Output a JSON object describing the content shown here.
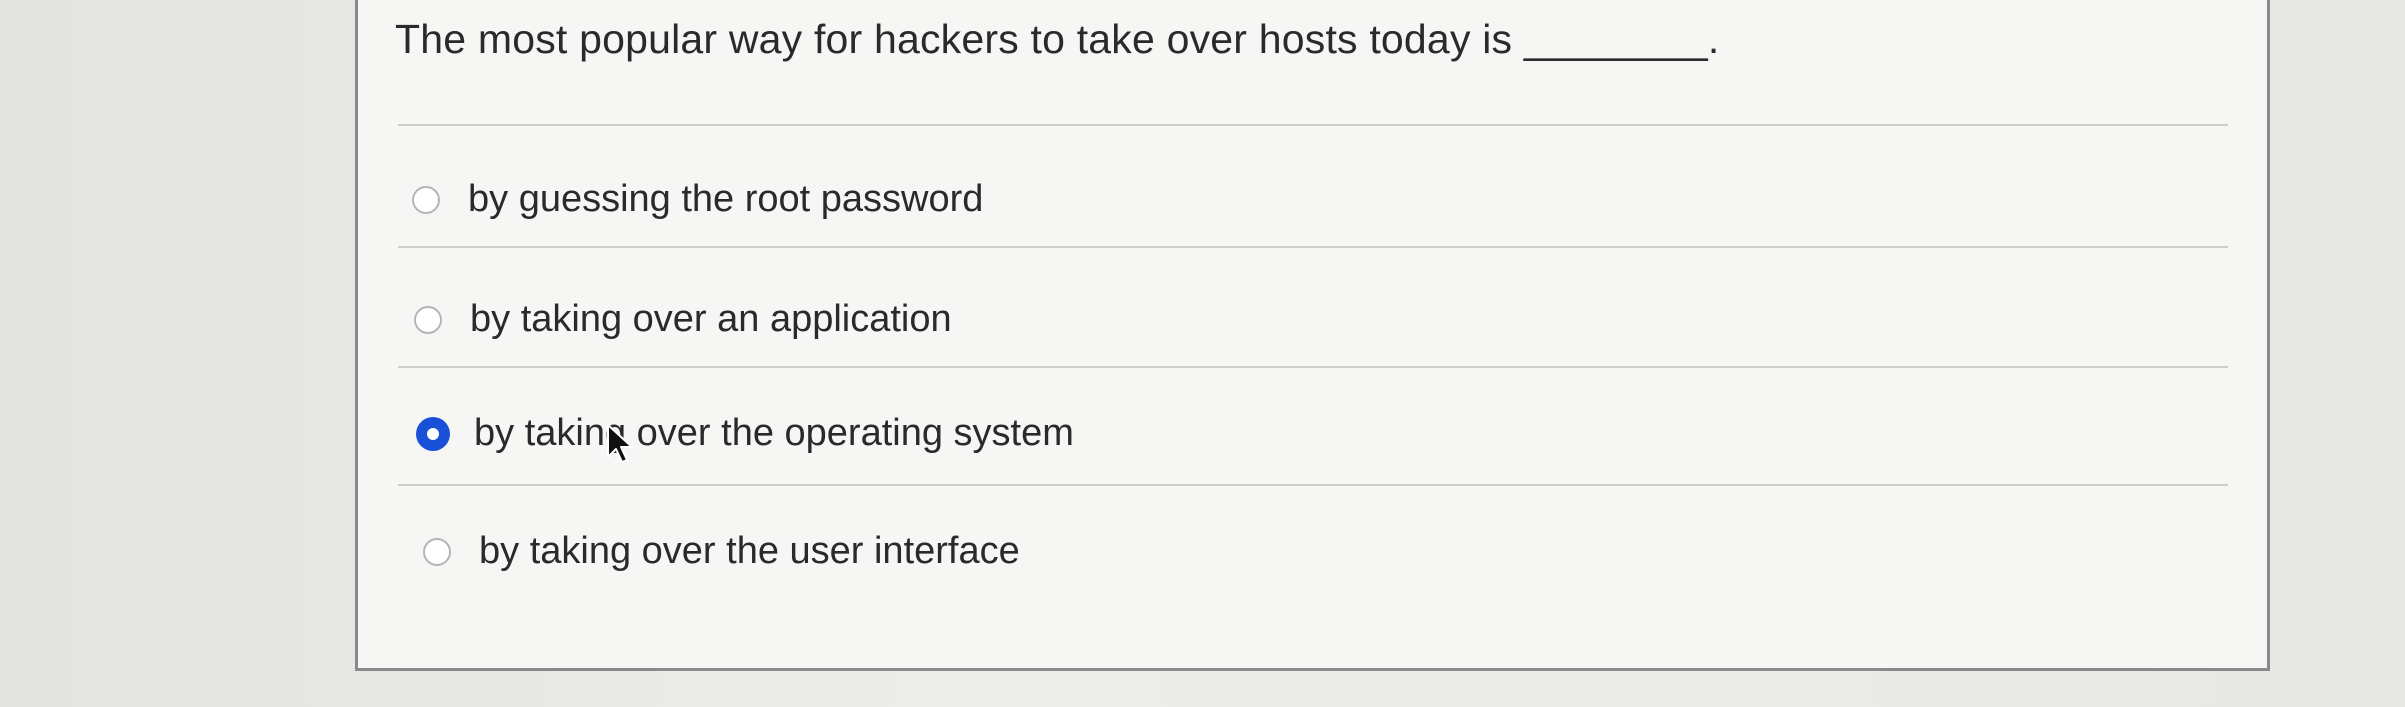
{
  "question": {
    "text": "The most popular way for hackers to take over hosts today is ________."
  },
  "options": [
    {
      "label": "by guessing the root password",
      "selected": false
    },
    {
      "label": "by taking over an application",
      "selected": false
    },
    {
      "label": "by taking over the operating system",
      "selected": true
    },
    {
      "label": "by taking over the user interface",
      "selected": false
    }
  ],
  "colors": {
    "selected_radio": "#1a4fd8",
    "text": "#2a2a2a",
    "card_background": "#f6f6f4"
  }
}
